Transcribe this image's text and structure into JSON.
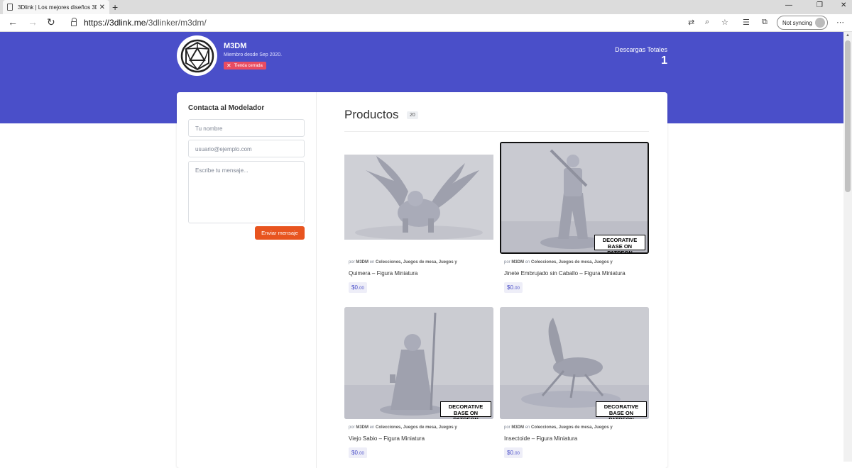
{
  "browser": {
    "tab_title": "3Dlink | Los mejores diseños 3D...",
    "url_domain": "https://3dlink.me",
    "url_path": "/3dlinker/m3dm/",
    "sync_label": "Not syncing"
  },
  "header": {
    "store_name": "M3DM",
    "member_since": "Miembro desde Sep 2020.",
    "closed_badge": "Tienda cerrada",
    "downloads_label": "Descargas Totales",
    "downloads_value": "1"
  },
  "contact": {
    "title": "Contacta al Modelador",
    "name_placeholder": "Tu nombre",
    "email_placeholder": "usuario@ejemplo.com",
    "message_placeholder": "Escribe tu mensaje...",
    "send_label": "Enviar mensaje"
  },
  "products": {
    "title": "Productos",
    "count": "20",
    "items": [
      {
        "title": "Quimera – Figura Miniatura",
        "author": "M3DM",
        "categories": "Colecciones, Juegos de mesa, Juegos y",
        "price_main": "$0.",
        "price_cents": "00",
        "badge": ""
      },
      {
        "title": "Jinete Embrujado sin Caballo – Figura Miniatura",
        "author": "M3DM",
        "categories": "Colecciones, Juegos de mesa, Juegos y",
        "price_main": "$0.",
        "price_cents": "00",
        "badge": "DECORATIVE BASE ON PATREON"
      },
      {
        "title": "Viejo Sabio – Figura Miniatura",
        "author": "M3DM",
        "categories": "Colecciones, Juegos de mesa, Juegos y",
        "price_main": "$0.",
        "price_cents": "00",
        "badge": "DECORATIVE BASE ON PATREON"
      },
      {
        "title": "Insectoide – Figura Miniatura",
        "author": "M3DM",
        "categories": "Colecciones, Juegos de mesa, Juegos y",
        "price_main": "$0.",
        "price_cents": "00",
        "badge": "DECORATIVE BASE ON PATREON"
      }
    ],
    "by_label": "por",
    "in_label": "en"
  },
  "colors": {
    "brand": "#4a4fc9",
    "button": "#e8541f",
    "badge": "#e94c62"
  }
}
